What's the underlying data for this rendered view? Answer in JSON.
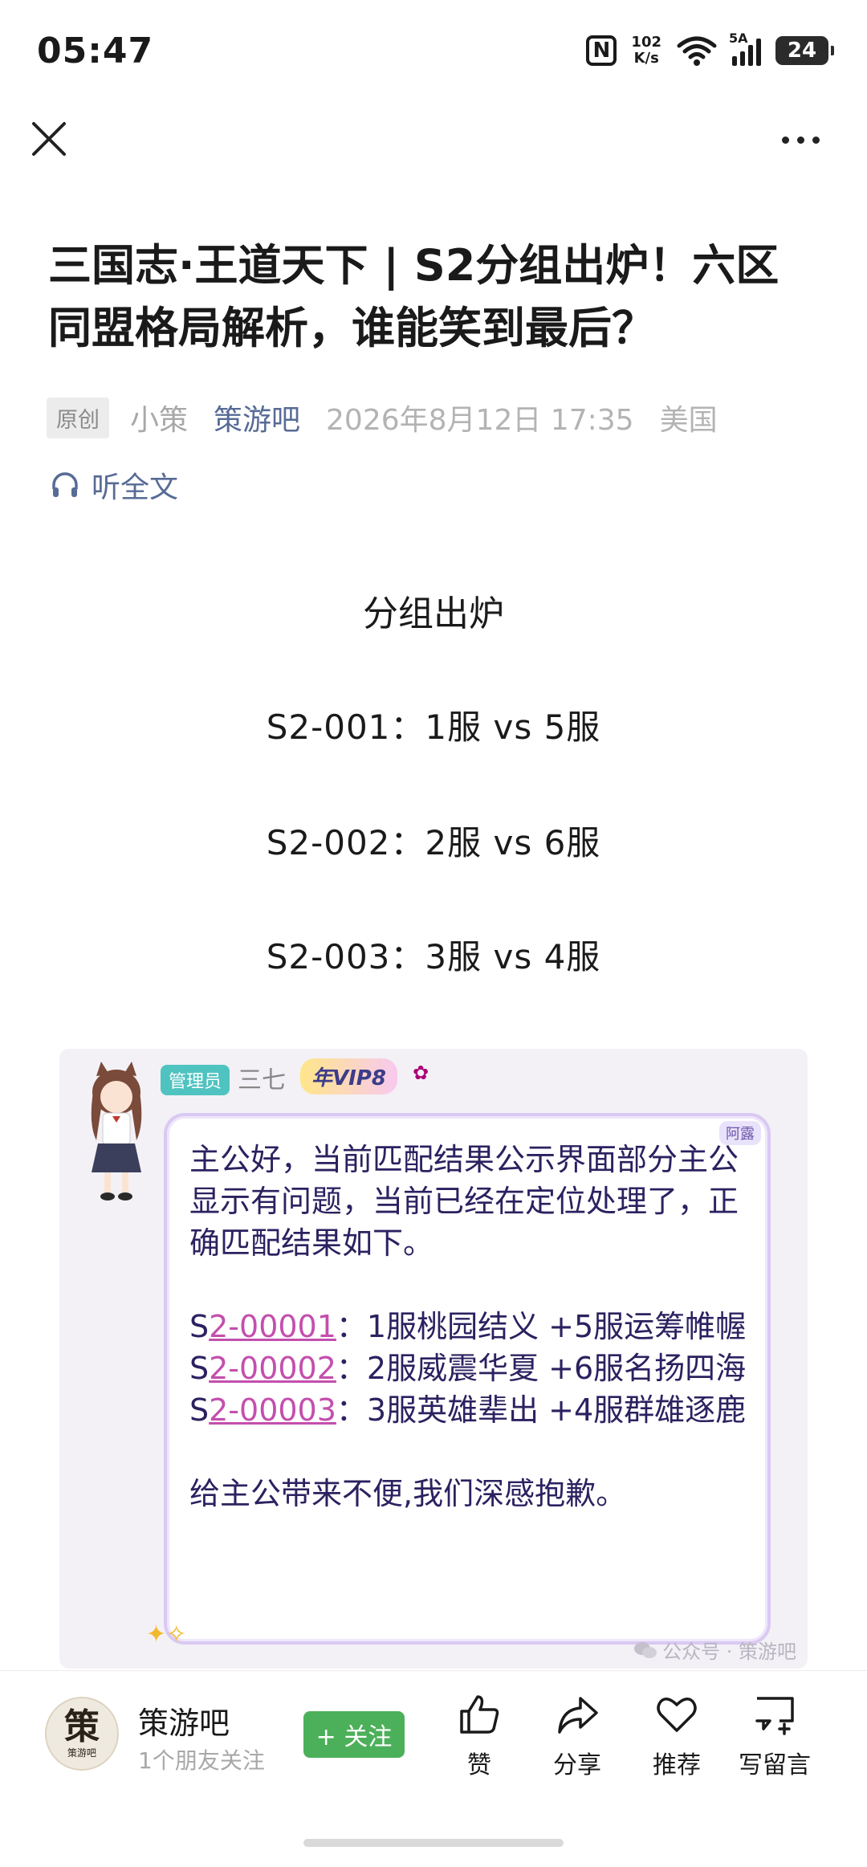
{
  "status_bar": {
    "time": "05:47",
    "nfc": "N",
    "speed_value": "102",
    "speed_unit": "K/s",
    "network": "5A",
    "battery": "24"
  },
  "nav": {
    "close_icon": "close-icon",
    "more_icon": "more-icon"
  },
  "article": {
    "title": "三国志·王道天下 | S2分组出炉！六区同盟格局解析，谁能笑到最后？",
    "badge": "原创",
    "author": "小策",
    "account": "策游吧",
    "date": "2026年8月12日 17:35",
    "location": "美国",
    "listen_label": "听全文"
  },
  "content": {
    "section_title": "分组出炉",
    "groups": [
      "S2-001：1服 vs 5服",
      "S2-002：2服 vs 6服",
      "S2-003：3服 vs 4服"
    ]
  },
  "embed": {
    "role_badge": "管理员",
    "role_name": "三七",
    "vip": "年VIP8",
    "bubble_tag": "阿露",
    "intro": "主公好，当前匹配结果公示界面部分主公显示有问题，当前已经在定位处理了，正确匹配结果如下。",
    "results": [
      {
        "prefix": "S",
        "code": "2-00001",
        "text": "：1服桃园结义 +5服运筹帷幄"
      },
      {
        "prefix": "S",
        "code": "2-00002",
        "text": "：2服威震华夏 +6服名扬四海"
      },
      {
        "prefix": "S",
        "code": "2-00003",
        "text": "：3服英雄辈出 +4服群雄逐鹿"
      }
    ],
    "apology": "给主公带来不便,我们深感抱歉。",
    "watermark": "公众号 · 策游吧"
  },
  "bottom_bar": {
    "account_logo_text": "策",
    "account_logo_sub": "策游吧",
    "account_name": "策游吧",
    "followers": "1个朋友关注",
    "follow_label": "+ 关注",
    "actions": [
      {
        "label": "赞",
        "icon": "thumbs-up-icon"
      },
      {
        "label": "分享",
        "icon": "share-icon"
      },
      {
        "label": "推荐",
        "icon": "heart-icon"
      },
      {
        "label": "写留言",
        "icon": "comment-icon"
      }
    ]
  }
}
